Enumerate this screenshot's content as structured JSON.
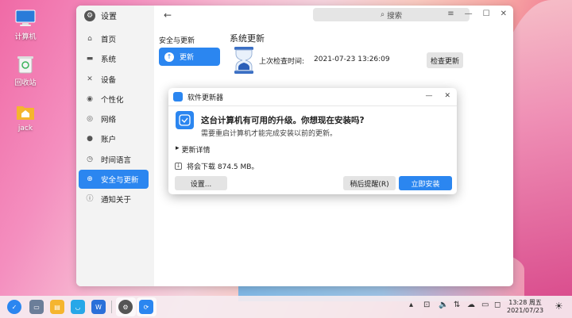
{
  "desktop": {
    "icons": [
      {
        "label": "计算机",
        "icon": "computer-icon"
      },
      {
        "label": "回收站",
        "icon": "trash-icon"
      },
      {
        "label": "jack",
        "icon": "home-folder-icon"
      }
    ]
  },
  "settings": {
    "title": "设置",
    "search_placeholder": "搜索",
    "sidebar": [
      {
        "label": "首页",
        "icon": "home-icon",
        "active": false
      },
      {
        "label": "系统",
        "icon": "monitor-icon",
        "active": false
      },
      {
        "label": "设备",
        "icon": "tools-icon",
        "active": false
      },
      {
        "label": "个性化",
        "icon": "palette-icon",
        "active": false
      },
      {
        "label": "网络",
        "icon": "globe-icon",
        "active": false
      },
      {
        "label": "账户",
        "icon": "user-icon",
        "active": false
      },
      {
        "label": "时间语言",
        "icon": "clock-icon",
        "active": false
      },
      {
        "label": "安全与更新",
        "icon": "shield-icon",
        "active": true
      },
      {
        "label": "通知关于",
        "icon": "info-icon",
        "active": false
      }
    ],
    "section": {
      "title": "安全与更新",
      "items": [
        {
          "label": "更新",
          "active": true
        }
      ]
    },
    "panel": {
      "title": "系统更新",
      "last_check_label": "上次检查时间:",
      "last_check_value": "2021-07-23 13:26:09",
      "check_button": "检查更新"
    }
  },
  "dialog": {
    "title": "软件更新器",
    "question": "这台计算机有可用的升级。你想现在安装吗?",
    "subtext": "需要重启计算机才能完成安装以前的更新。",
    "details_label": "更新详情",
    "download_text": "将会下载 874.5 MB。",
    "settings_button": "设置...",
    "later_button": "稍后提醒(R)",
    "install_button": "立即安装"
  },
  "taskbar": {
    "time": "13:28 周五",
    "date": "2021/07/23"
  },
  "colors": {
    "accent": "#2b86f0"
  }
}
